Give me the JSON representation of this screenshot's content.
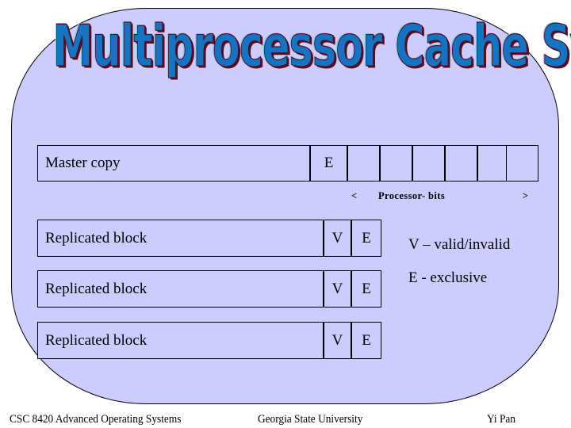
{
  "slide": {
    "title": "Multiprocessor Cache System",
    "background_color": "#ccccff",
    "border_color": "#000000",
    "title_fill_color": "#1474c4",
    "title_shadow_color": "#5a0d1e",
    "title_highlight_color": "#86c9f2"
  },
  "master_row": {
    "label": "Master copy",
    "exclusive_cell": "E",
    "processor_bits": [
      "",
      "",
      "",
      "",
      "",
      ""
    ]
  },
  "processor_bits_caption": {
    "left_bracket": "<",
    "text": "Processor- bits",
    "right_bracket": ">"
  },
  "replicated_rows": [
    {
      "label": "Replicated block",
      "valid_cell": "V",
      "exclusive_cell": "E"
    },
    {
      "label": "Replicated block",
      "valid_cell": "V",
      "exclusive_cell": "E"
    },
    {
      "label": "Replicated block",
      "valid_cell": "V",
      "exclusive_cell": "E"
    }
  ],
  "legend": {
    "valid": "V – valid/invalid",
    "exclusive": "E - exclusive"
  },
  "footer": {
    "left": "CSC 8420 Advanced Operating Systems",
    "center": "Georgia State University",
    "right": "Yi Pan"
  }
}
